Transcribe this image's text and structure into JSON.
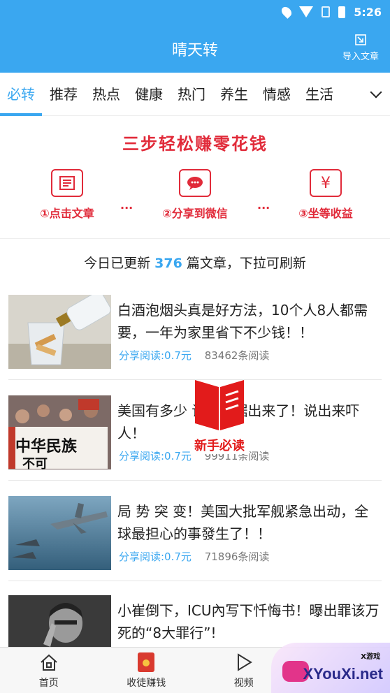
{
  "status": {
    "time": "5:26"
  },
  "header": {
    "title": "晴天转",
    "import_label": "导入文章"
  },
  "tabs": [
    {
      "label": "必转",
      "active": true
    },
    {
      "label": "推荐"
    },
    {
      "label": "热点"
    },
    {
      "label": "健康"
    },
    {
      "label": "热门"
    },
    {
      "label": "养生"
    },
    {
      "label": "情感"
    },
    {
      "label": "生活"
    }
  ],
  "banner": {
    "title": "三步轻松赚零花钱",
    "steps": [
      {
        "label": "①点击文章",
        "icon": "article-icon"
      },
      {
        "label": "②分享到微信",
        "icon": "wechat-icon"
      },
      {
        "label": "③坐等收益",
        "icon": "yen-icon"
      }
    ],
    "separator": "..."
  },
  "notice": {
    "prefix": "今日已更新 ",
    "count": "376",
    "suffix": " 篇文章，下拉可刷新"
  },
  "articles": [
    {
      "title": "白酒泡烟头真是好方法，10个人8人都需要，一年为家里省下不少钱！！",
      "share": "分享阅读:0.7元",
      "reads": "83462条阅读"
    },
    {
      "title": "美国有多少       详细数据出来了！说出来吓人！",
      "share": "分享阅读:0.7元",
      "reads": "99911条阅读"
    },
    {
      "title": "局 势 突 变！美国大批军舰紧急出动，全球最担心的事發生了！！",
      "share": "分享阅读:0.7元",
      "reads": "71896条阅读"
    },
    {
      "title": "小崔倒下，ICU內写下忏悔书！曝出罪该万死的“8大罪行”!",
      "share": "",
      "reads": ""
    }
  ],
  "overlay": {
    "label": "新手必读"
  },
  "bottom_nav": [
    {
      "label": "首页",
      "icon": "home-icon"
    },
    {
      "label": "收徒赚钱",
      "icon": "red-envelope-icon"
    },
    {
      "label": "视频",
      "icon": "play-icon"
    }
  ],
  "watermark": {
    "text": "XYouXi.net",
    "small": "X游戏"
  },
  "colors": {
    "primary": "#3aa7f0",
    "accent_red": "#e12b3a"
  }
}
